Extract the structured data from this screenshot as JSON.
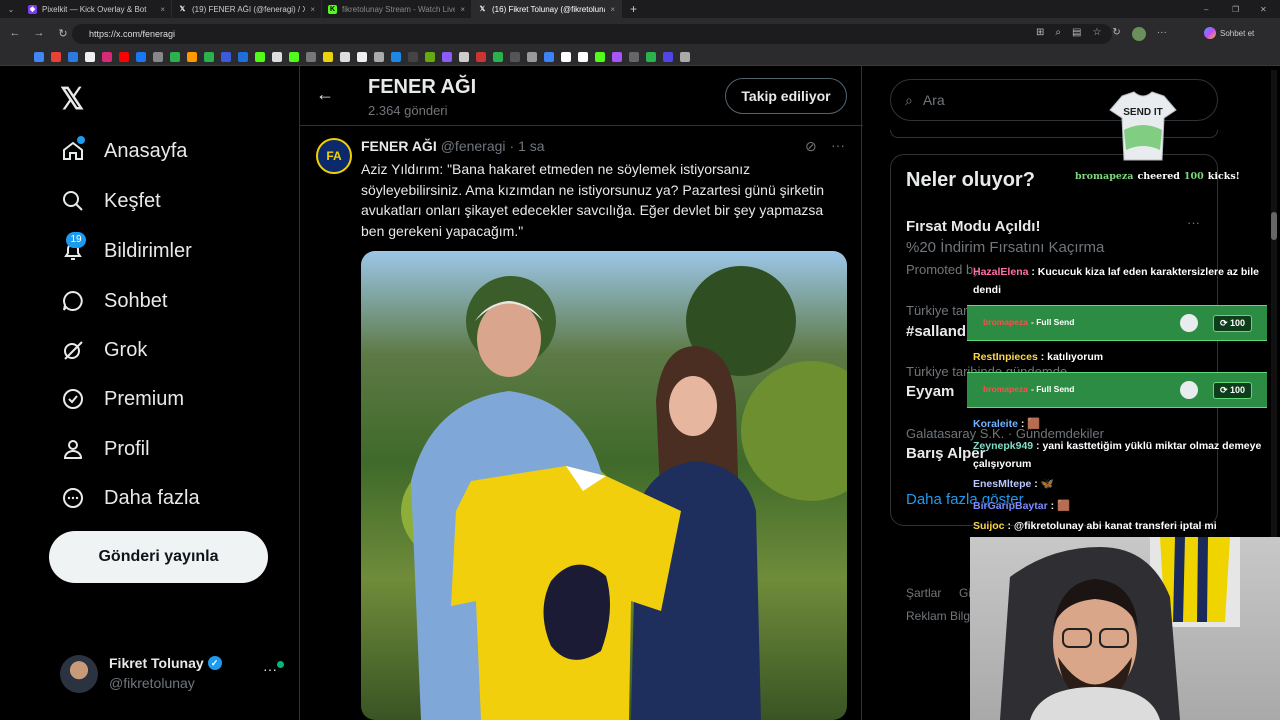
{
  "browser": {
    "tabs": [
      {
        "label": "Pixelkit — Kick Overlay & Bot",
        "icon": "pixelkit-icon",
        "active": false
      },
      {
        "label": "(19) FENER AĞI (@feneragi) / X",
        "icon": "x-icon",
        "active": false
      },
      {
        "label": "fikretolunay Stream - Watch Live",
        "icon": "kick-icon",
        "active": false
      },
      {
        "label": "(16) Fikret Tolunay (@fikretolunay)",
        "icon": "x-icon",
        "active": true
      }
    ],
    "url": "https://x.com/feneragi",
    "sidebar_btn": "Sohbet et"
  },
  "nav": {
    "items": [
      {
        "label": "Anasayfa",
        "icon": "home-icon"
      },
      {
        "label": "Keşfet",
        "icon": "search-icon"
      },
      {
        "label": "Bildirimler",
        "icon": "bell-icon",
        "badge": "19"
      },
      {
        "label": "Sohbet",
        "icon": "chat-icon"
      },
      {
        "label": "Grok",
        "icon": "grok-icon"
      },
      {
        "label": "Premium",
        "icon": "verified-icon"
      },
      {
        "label": "Profil",
        "icon": "person-icon"
      },
      {
        "label": "Daha fazla",
        "icon": "more-circle-icon"
      }
    ],
    "post_button": "Gönderi yayınla",
    "account": {
      "name": "Fikret Tolunay",
      "handle": "@fikretolunay"
    }
  },
  "profile_header": {
    "name": "FENER AĞI",
    "posts": "2.364 gönderi",
    "follow_button": "Takip ediliyor"
  },
  "post": {
    "author": "FENER AĞI",
    "handle": "@feneragi",
    "time": "· 1 sa",
    "text": "Aziz Yıldırım: \"Bana hakaret etmeden ne söylemek istiyorsanız söyleyebilirsiniz. Ama kızımdan ne istiyorsunuz ya? Pazartesi günü şirketin avukatları onları şikayet edecekler savcılığa. Eğer devlet bir şey yapmazsa ben gerekeni yapacağım.\""
  },
  "right": {
    "search_placeholder": "Ara",
    "trends_title": "Neler oluyor?",
    "promo_title": "Fırsat Modu Açıldı!",
    "promo_sub": "%20 İndirim Fırsatını Kaçırma",
    "promo_tag": "Promoted by ...",
    "trend1_ctx": "Türkiye tarihinde gündemde",
    "trend1": "#sallandık",
    "trend2_ctx": "Türkiye tarihinde gündemde",
    "trend2": "Eyyam",
    "trend3_ctx": "Galatasaray S.K. · Gündemdekiler",
    "trend3": "Barış Alper",
    "show_more": "Daha fazla göster",
    "footer1": "Şartlar",
    "footer2": "Gi",
    "footer3": "Reklam Bilgile"
  },
  "overlay": {
    "cheer": {
      "user": "bromapeza",
      "verb": "cheered",
      "amount": "100",
      "unit": "kicks!"
    },
    "sticker_text": "SEND IT",
    "chat": [
      {
        "user": "HazalElena",
        "color": "#ff6fa8",
        "text": ": Kucucuk kiza laf eden karaktersizlere az bile dendi"
      },
      {
        "user": "RestInpieces",
        "color": "#ffd54a",
        "text": ": katılıyorum"
      },
      {
        "user": "Koraleite",
        "color": "#6fb4ff",
        "text": ": 🟫"
      },
      {
        "user": "Zeynepk949",
        "color": "#7fe0c8",
        "text": ": yani kasttetiğim yüklü miktar olmaz demeye çalışıyorum"
      },
      {
        "user": "EnesMltepe",
        "color": "#b9c7ff",
        "text": ": 🦋"
      },
      {
        "user": "BirGaripBaytar",
        "color": "#7d8bff",
        "text": ": 🟫"
      },
      {
        "user": "Suijoc",
        "color": "#ffd54a",
        "text": ": @fikretolunay abi kanat transferi iptal mi"
      }
    ],
    "send_events": [
      {
        "user": "bromapeza",
        "label": "- Full Send",
        "amount": "100"
      },
      {
        "user": "bromapeza",
        "label": "- Full Send",
        "amount": "100"
      }
    ]
  }
}
